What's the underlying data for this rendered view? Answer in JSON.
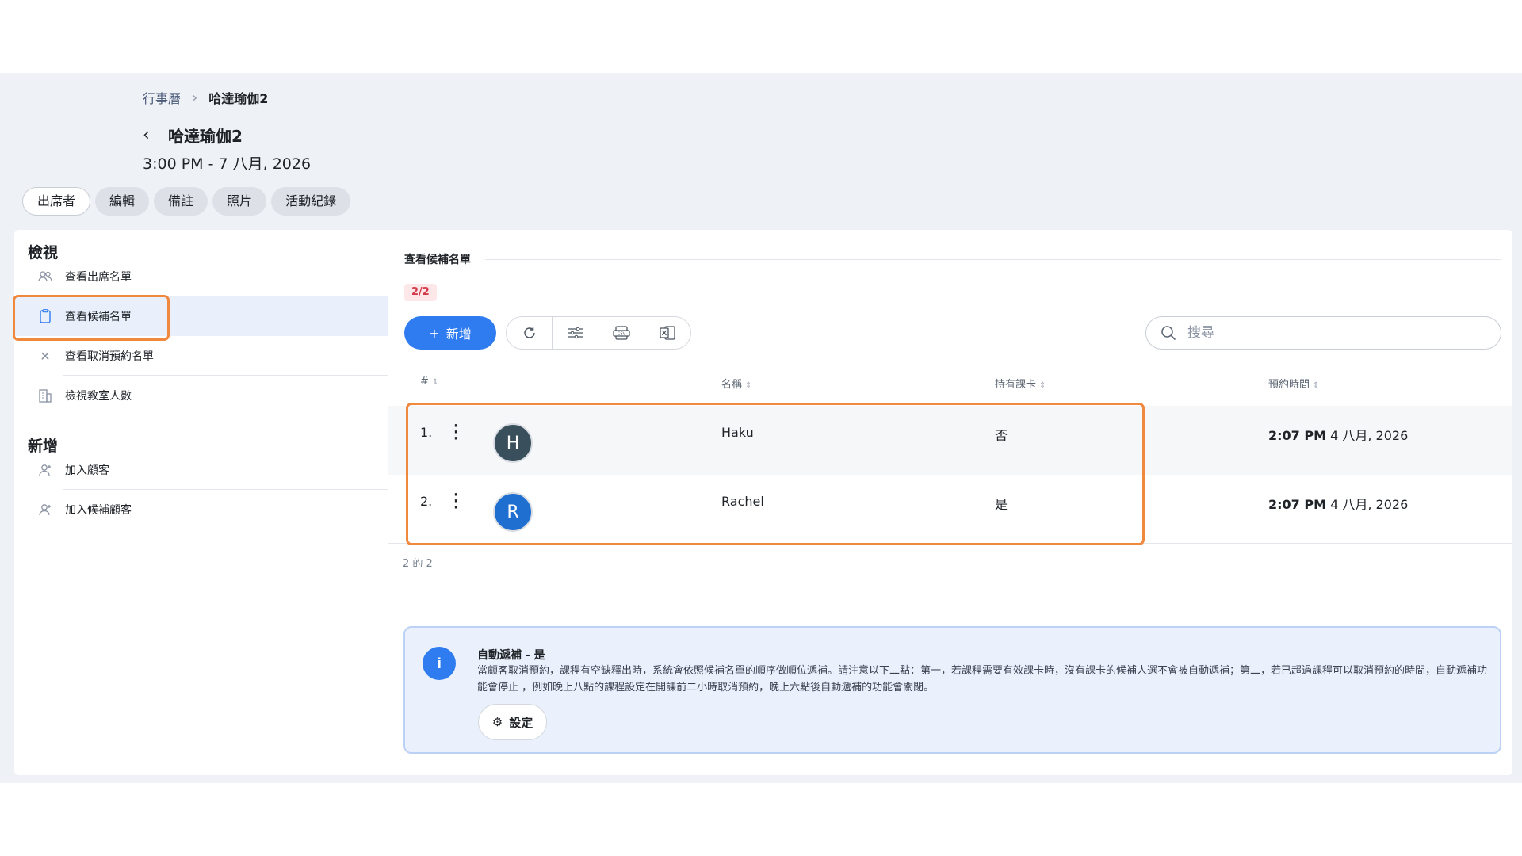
{
  "breadcrumb": {
    "parent": "行事曆",
    "separator": ">",
    "current": "哈達瑜伽2"
  },
  "header": {
    "back_icon": "chevron-left-icon",
    "title": "哈達瑜伽2",
    "datetime": "3:00 PM - 7 八月, 2026"
  },
  "tabs": [
    {
      "label": "出席者",
      "active": true
    },
    {
      "label": "編輯",
      "active": false
    },
    {
      "label": "備註",
      "active": false
    },
    {
      "label": "照片",
      "active": false
    },
    {
      "label": "活動紀錄",
      "active": false
    }
  ],
  "sidebar": {
    "view_heading": "檢視",
    "view_items": [
      {
        "label": "查看出席名單",
        "icon": "users-icon"
      },
      {
        "label": "查看候補名單",
        "icon": "clipboard-icon",
        "active": true
      },
      {
        "label": "查看取消預約名單",
        "icon": "close-icon"
      },
      {
        "label": "檢視教室人數",
        "icon": "building-icon"
      }
    ],
    "add_heading": "新增",
    "add_items": [
      {
        "label": "加入顧客",
        "icon": "add-user-icon"
      },
      {
        "label": "加入候補顧客",
        "icon": "add-user-icon"
      }
    ]
  },
  "main": {
    "section_title": "查看候補名單",
    "count_badge": "2/2",
    "add_button": {
      "icon": "plus-icon",
      "label": "新增"
    },
    "toolbar_icons": [
      "refresh-icon",
      "filter-icon",
      "csv-export-icon",
      "excel-export-icon"
    ],
    "search": {
      "icon": "search-icon",
      "placeholder": "搜尋",
      "value": ""
    },
    "columns": [
      "#",
      "名稱",
      "持有課卡",
      "預約時間"
    ],
    "rows": [
      {
        "index": "1.",
        "avatar_letter": "H",
        "avatar_color": "#3a4f5c",
        "name": "Haku",
        "has_card": "否",
        "time_bold": "2:07 PM",
        "date": "4 八月, 2026"
      },
      {
        "index": "2.",
        "avatar_letter": "R",
        "avatar_color": "#1f6fd1",
        "name": "Rachel",
        "has_card": "是",
        "time_bold": "2:07 PM",
        "date": "4 八月, 2026"
      }
    ],
    "pagination": "2 的 2",
    "info": {
      "icon": "info-icon",
      "title": "自動遞補 - 是",
      "text": "當顧客取消預約，課程有空缺釋出時，系統會依照候補名單的順序做順位遞補。請注意以下二點：第一，若課程需要有效課卡時，沒有課卡的候補人選不會被自動遞補；第二，若已超過課程可以取消預約的時間，自動遞補功能會停止 ，例如晚上八點的課程設定在開課前二小時取消預約，晚上六點後自動遞補的功能會關閉。",
      "settings_icon": "gear-icon",
      "settings_label": "設定"
    }
  },
  "colors": {
    "accent": "#2f7bf0",
    "highlight": "#f0883e",
    "badge_red": "#d33b4a"
  }
}
